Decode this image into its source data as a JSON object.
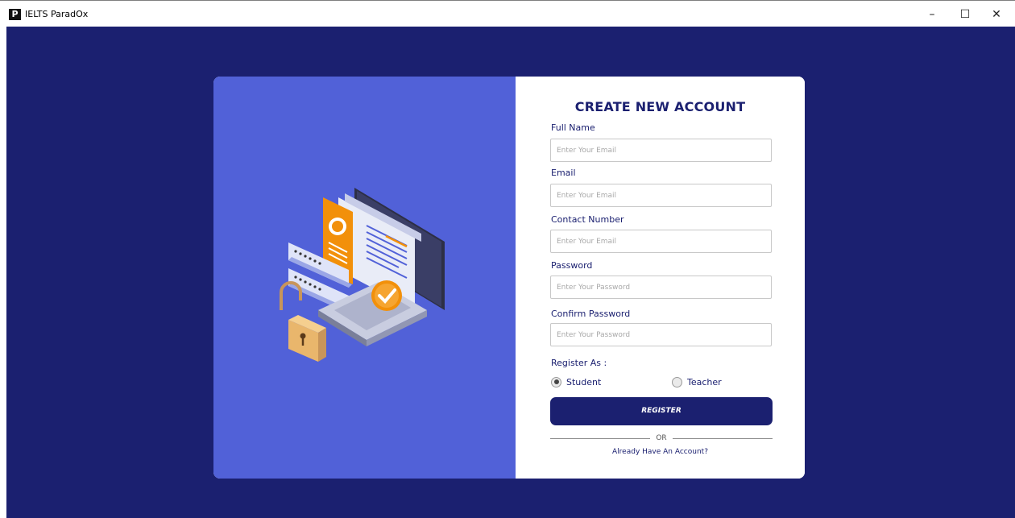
{
  "window": {
    "logo_letter": "P",
    "title": "IELTS ParadOx",
    "minimize_glyph": "–",
    "maximize_glyph": "☐",
    "close_glyph": "✕"
  },
  "form": {
    "title": "CREATE NEW ACCOUNT",
    "fields": [
      {
        "label": "Full Name",
        "placeholder": "Enter Your Email",
        "value": ""
      },
      {
        "label": "Email",
        "placeholder": "Enter Your Email",
        "value": ""
      },
      {
        "label": "Contact Number",
        "placeholder": "Enter Your Email",
        "value": ""
      },
      {
        "label": "Password",
        "placeholder": "Enter Your Password",
        "value": ""
      },
      {
        "label": "Confirm Password",
        "placeholder": "Enter Your Password",
        "value": ""
      }
    ],
    "register_as_label": "Register As :",
    "roles": [
      {
        "label": "Student",
        "selected": true
      },
      {
        "label": "Teacher",
        "selected": false
      }
    ],
    "register_button": "REGISTER",
    "or_text": "OR",
    "login_link": "Already Have An Account?"
  },
  "illustration": {
    "icon": "account-security-illustration"
  },
  "colors": {
    "navy": "#1b2070",
    "panel_blue": "#5161d8",
    "orange": "#f2900a"
  }
}
